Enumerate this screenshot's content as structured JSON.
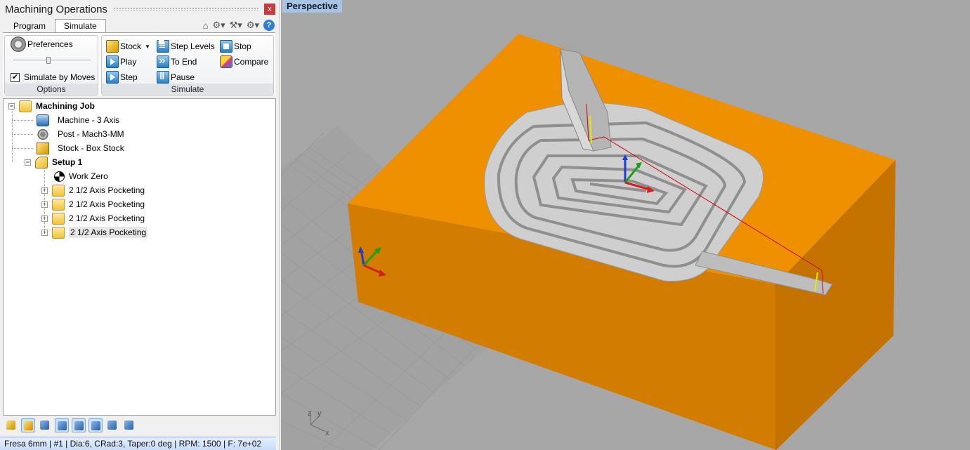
{
  "panel": {
    "title": "Machining Operations",
    "close_label": "x",
    "tabs": [
      {
        "label": "Program",
        "active": false
      },
      {
        "label": "Simulate",
        "active": true
      }
    ],
    "help_label": "?"
  },
  "ribbon": {
    "options": {
      "preferences_label": "Preferences",
      "simulate_by_moves_label": "Simulate by Moves",
      "simulate_by_moves_checked": true,
      "group_label": "Options"
    },
    "simulate": {
      "stock_label": "Stock",
      "play_label": "Play",
      "step_label": "Step",
      "step_levels_label": "Step Levels",
      "to_end_label": "To End",
      "pause_label": "Pause",
      "stop_label": "Stop",
      "compare_label": "Compare",
      "group_label": "Simulate"
    }
  },
  "tree": {
    "job": "Machining Job",
    "machine": "Machine - 3 Axis",
    "post": "Post - Mach3-MM",
    "stock": "Stock - Box Stock",
    "setup": "Setup 1",
    "work_zero": "Work Zero",
    "operations": [
      "2 1/2 Axis Pocketing",
      "2 1/2 Axis Pocketing",
      "2 1/2 Axis Pocketing",
      "2 1/2 Axis Pocketing"
    ],
    "expander_collapsed": "+",
    "expander_expanded": "−"
  },
  "status_bar": "Fresa 6mm | #1 | Dia:6, CRad:3, Taper:0 deg | RPM: 1500 | F: 7e+02",
  "viewport": {
    "label": "Perspective",
    "axis_labels": {
      "z": "z",
      "y": "y",
      "x": "x"
    },
    "colors": {
      "stock": "#ee9000",
      "stock_side": "#d27c00",
      "toolpath": "#d20000",
      "background": "#a7a7a7"
    }
  }
}
